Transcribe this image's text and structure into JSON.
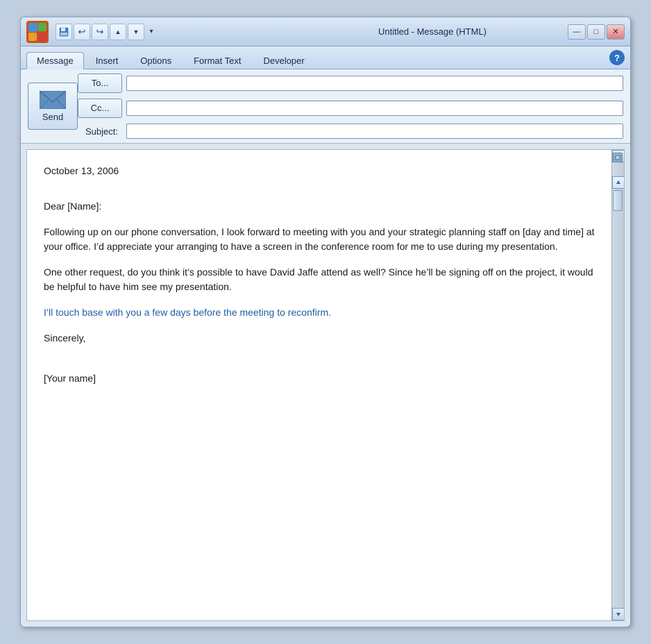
{
  "window": {
    "title": "Untitled - Message (HTML)",
    "min_label": "—",
    "max_label": "□",
    "close_label": "✕"
  },
  "toolbar": {
    "save_icon": "💾",
    "undo_icon": "↩",
    "redo_icon": "↪",
    "up_icon": "▲",
    "down_icon": "▼",
    "dropdown_icon": "▾"
  },
  "ribbon": {
    "tabs": [
      {
        "label": "Message",
        "active": true
      },
      {
        "label": "Insert",
        "active": false
      },
      {
        "label": "Options",
        "active": false
      },
      {
        "label": "Format Text",
        "active": false
      },
      {
        "label": "Developer",
        "active": false
      }
    ],
    "help_label": "?"
  },
  "form": {
    "send_label": "Send",
    "to_label": "To...",
    "cc_label": "Cc...",
    "subject_label": "Subject:",
    "to_value": "",
    "cc_value": "",
    "subject_value": ""
  },
  "email": {
    "date": "October 13, 2006",
    "greeting": "Dear [Name]:",
    "paragraph1": "Following up on our phone conversation, I look forward to meeting with you and your strategic planning staff on [day and time] at your office. I’d appreciate your arranging to have a screen in the conference room for me to use during my presentation.",
    "paragraph2": "One other request, do you think it’s possible to have David Jaffe attend as well? Since he’ll be signing off on the project, it would be helpful to have him see my presentation.",
    "paragraph3": "I’ll touch base with you a few days before the meeting to reconfirm.",
    "closing": "Sincerely,",
    "signature": "[Your name]"
  }
}
